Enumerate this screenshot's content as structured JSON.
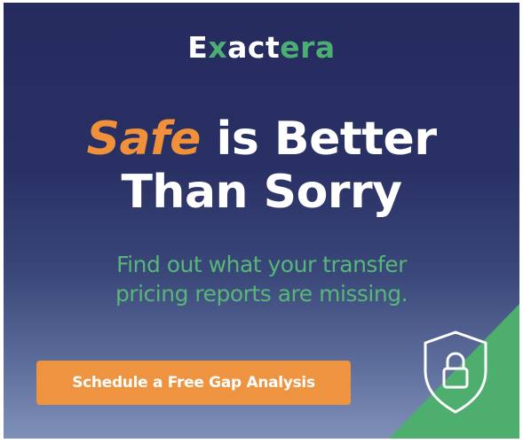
{
  "brand": {
    "logo_part1": "E",
    "logo_x": "x",
    "logo_part2": "act",
    "logo_part3": "era"
  },
  "headline": {
    "accent_word": "Safe",
    "line1_rest": " is Better",
    "line2": "Than Sorry"
  },
  "subtext": {
    "line1": "Find out what your transfer",
    "line2": "pricing reports are missing."
  },
  "cta": {
    "label": "Schedule a Free Gap Analysis"
  },
  "icons": {
    "shield": "shield-lock-icon"
  },
  "colors": {
    "background_top": "#262b5e",
    "background_bottom": "#7f90b8",
    "accent_orange": "#f0903a",
    "brand_green": "#4caf72",
    "button": "#ee9440"
  }
}
